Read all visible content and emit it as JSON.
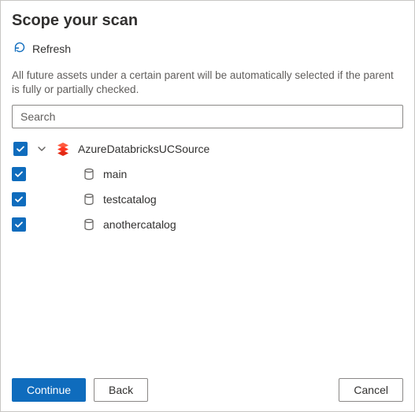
{
  "title": "Scope your scan",
  "refresh_label": "Refresh",
  "description": "All future assets under a certain parent will be automatically selected if the parent is fully or partially checked.",
  "search": {
    "placeholder": "Search",
    "value": ""
  },
  "tree": {
    "root": {
      "label": "AzureDatabricksUCSource",
      "checked": true,
      "expanded": true,
      "icon": "databricks-icon"
    },
    "children": [
      {
        "label": "main",
        "checked": true,
        "icon": "catalog-icon"
      },
      {
        "label": "testcatalog",
        "checked": true,
        "icon": "catalog-icon"
      },
      {
        "label": "anothercatalog",
        "checked": true,
        "icon": "catalog-icon"
      }
    ]
  },
  "buttons": {
    "continue": "Continue",
    "back": "Back",
    "cancel": "Cancel"
  },
  "colors": {
    "accent": "#0f6cbd",
    "databricks": "#ff3621"
  }
}
